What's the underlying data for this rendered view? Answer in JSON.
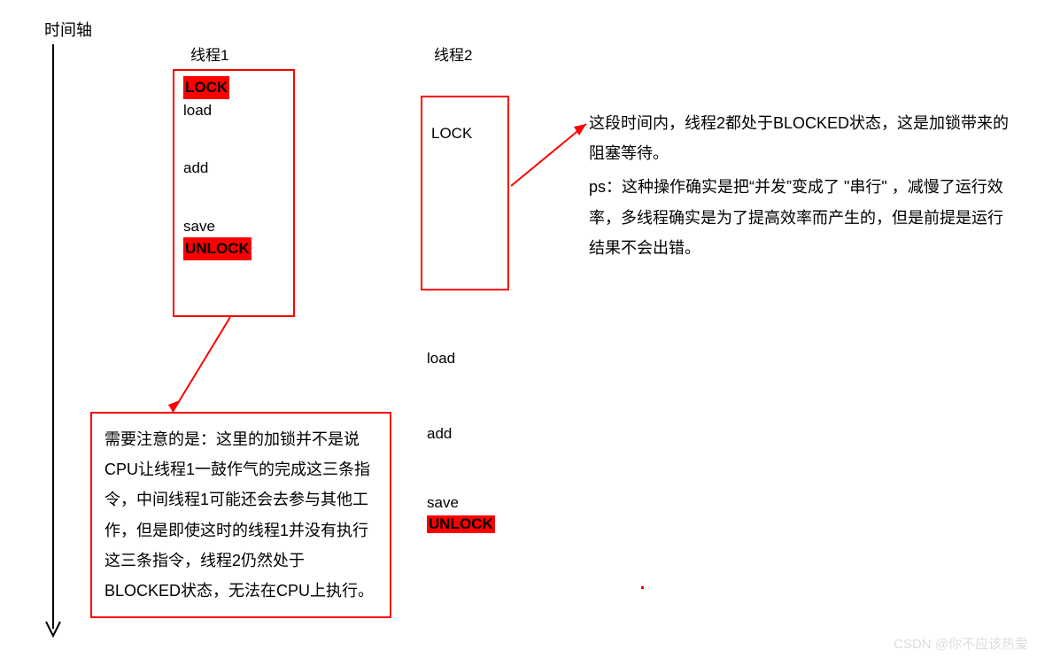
{
  "labels": {
    "time_axis": "时间轴",
    "thread1": "线程1",
    "thread2": "线程2"
  },
  "thread1_ops": {
    "lock": "LOCK",
    "load": "load",
    "add": "add",
    "save": "save",
    "unlock": "UNLOCK"
  },
  "thread2_ops": {
    "lock": "LOCK",
    "load": "load",
    "add": "add",
    "save": "save",
    "unlock": "UNLOCK"
  },
  "note_bottom": "需要注意的是：这里的加锁并不是说CPU让线程1一鼓作气的完成这三条指令，中间线程1可能还会去参与其他工作，但是即使这时的线程1并没有执行这三条指令，线程2仍然处于BLOCKED状态，无法在CPU上执行。",
  "note_right_1": "这段时间内，线程2都处于BLOCKED状态，这是加锁带来的阻塞等待。",
  "note_right_2": "ps：这种操作确实是把“并发”变成了 \"串行\" ，减慢了运行效率，多线程确实是为了提高效率而产生的，但是前提是运行结果不会出错。",
  "watermark": "CSDN @你不应该热爱"
}
